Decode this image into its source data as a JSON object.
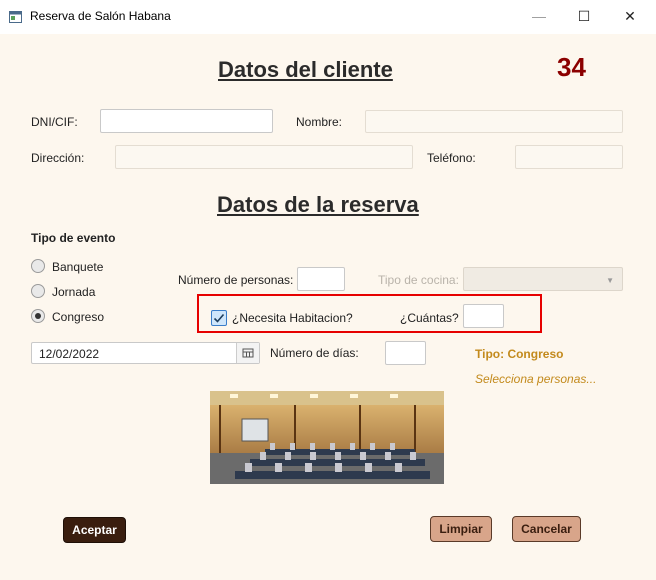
{
  "window": {
    "title": "Reserva de Salón Habana",
    "minimize": "—",
    "maximize": "☐",
    "close": "✕"
  },
  "counter": "34",
  "client_section": {
    "heading": "Datos del cliente",
    "dni_label": "DNI/CIF:",
    "dni_value": "",
    "nombre_label": "Nombre:",
    "nombre_value": "",
    "direccion_label": "Dirección:",
    "direccion_value": "",
    "telefono_label": "Teléfono:",
    "telefono_value": ""
  },
  "reserva_section": {
    "heading": "Datos de la reserva",
    "tipo_evento_label": "Tipo de evento",
    "events": [
      {
        "label": "Banquete",
        "selected": false
      },
      {
        "label": "Jornada",
        "selected": false
      },
      {
        "label": "Congreso",
        "selected": true
      }
    ],
    "personas_label": "Número de personas:",
    "personas_value": "",
    "cocina_label": "Tipo de cocina:",
    "cocina_value": "",
    "habitacion_label": "¿Necesita Habitacion?",
    "habitacion_checked": true,
    "cuantas_label": "¿Cuántas?",
    "cuantas_value": "",
    "fecha_value": "12/02/2022",
    "dias_label": "Número de días:",
    "dias_value": "",
    "tipo_status": "Tipo: Congreso",
    "hint": "Selecciona personas..."
  },
  "buttons": {
    "aceptar": "Aceptar",
    "limpiar": "Limpiar",
    "cancelar": "Cancelar"
  },
  "colors": {
    "background": "#fdf7ee",
    "counter": "#8b0000",
    "accent": "#c38a1c",
    "highlight": "#e60000",
    "button_dark": "#3a1e0f",
    "button_light": "#d8a58a"
  }
}
